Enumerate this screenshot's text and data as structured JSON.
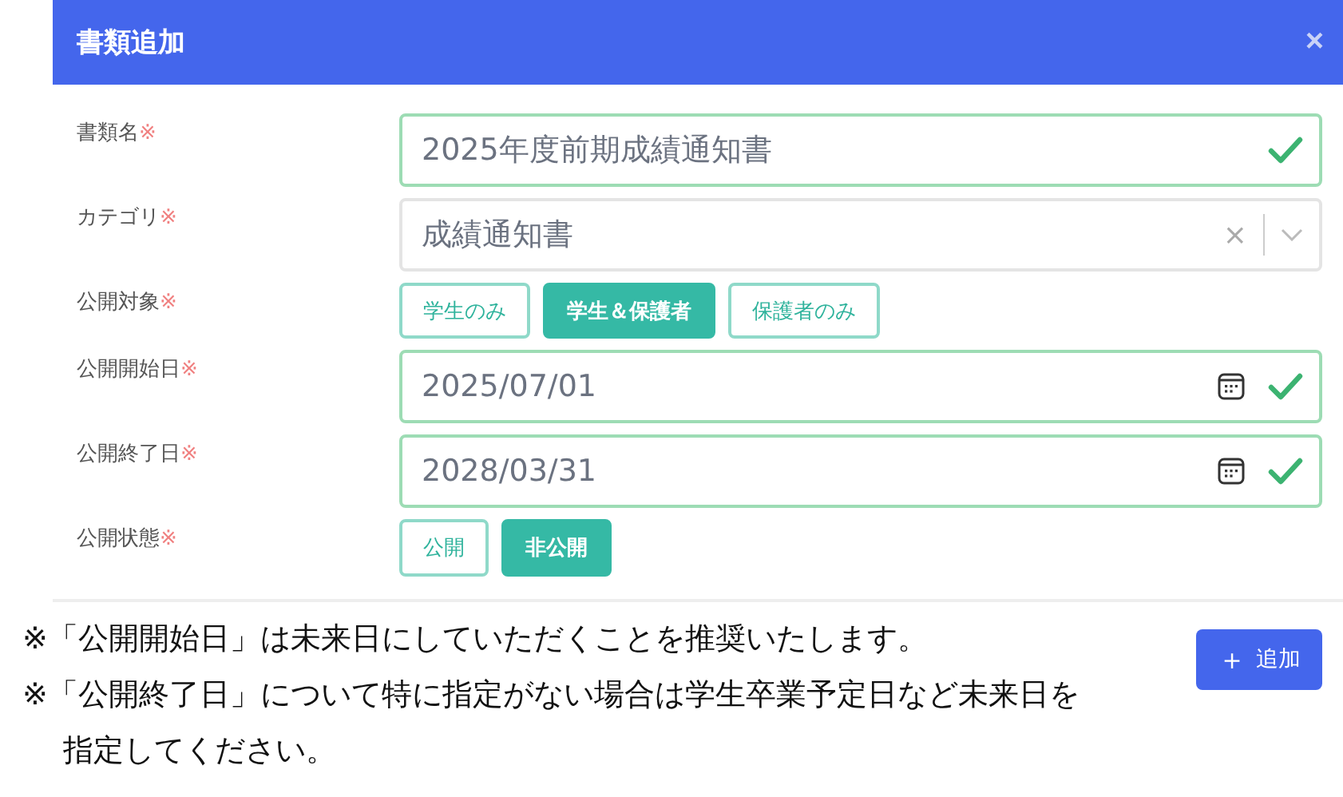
{
  "dialog": {
    "title": "書類追加",
    "close": "×"
  },
  "fields": [
    {
      "kind": "text",
      "label": "書類名",
      "required": "※",
      "value": "2025年度前期成績通知書",
      "valid": true
    },
    {
      "kind": "select",
      "label": "カテゴリ",
      "required": "※",
      "value": "成績通知書",
      "clear": "×"
    },
    {
      "kind": "segmented",
      "label": "公開対象",
      "required": "※",
      "options": [
        {
          "label": "学生のみ",
          "selected": false
        },
        {
          "label": "学生＆保護者",
          "selected": true
        },
        {
          "label": "保護者のみ",
          "selected": false
        }
      ]
    },
    {
      "kind": "date",
      "label": "公開開始日",
      "required": "※",
      "value": "2025/07/01",
      "valid": true
    },
    {
      "kind": "date",
      "label": "公開終了日",
      "required": "※",
      "value": "2028/03/31",
      "valid": true
    },
    {
      "kind": "segmented",
      "label": "公開状態",
      "required": "※",
      "options": [
        {
          "label": "公開",
          "selected": false
        },
        {
          "label": "非公開",
          "selected": true
        }
      ]
    }
  ],
  "notes": [
    "※「公開開始日」は未来日にしていただくことを推奨いたします。",
    "※「公開終了日」について特に指定がない場合は学生卒業予定日など未来日を指定してください。"
  ],
  "add_button": {
    "icon": "＋",
    "label": "追加"
  }
}
